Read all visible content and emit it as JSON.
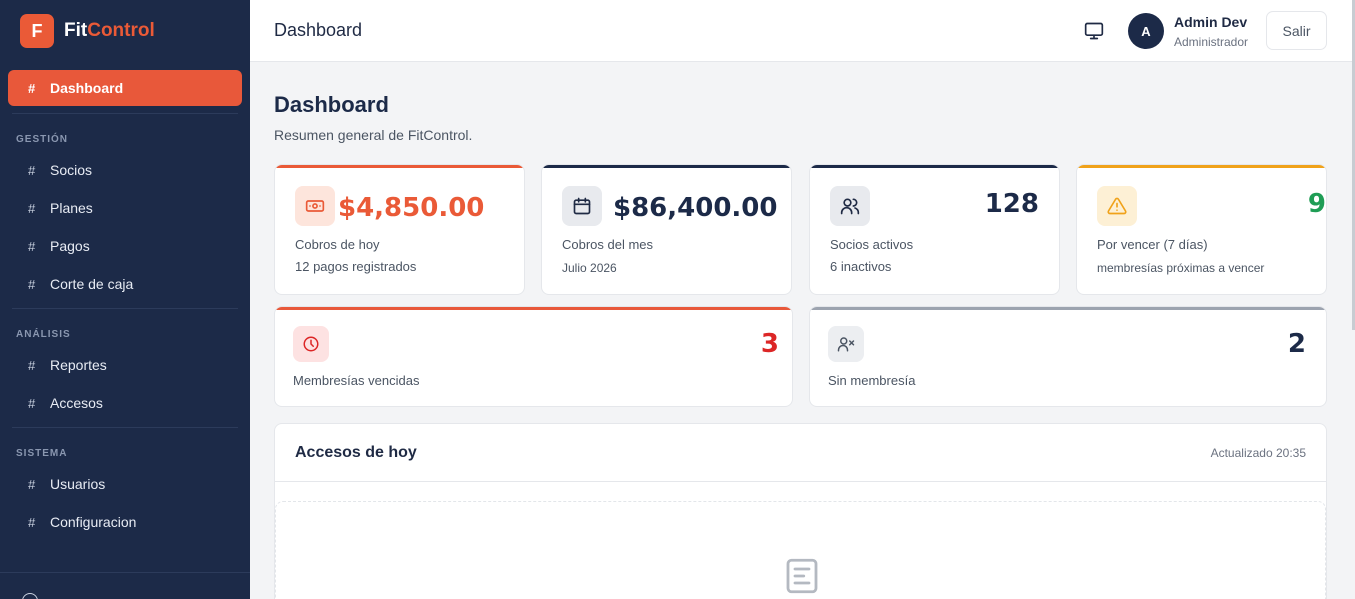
{
  "brand": {
    "logo_letter": "F",
    "name_part1": "Fit",
    "name_part2": "Control"
  },
  "sidebar": {
    "hash": "#",
    "main_item": "Dashboard",
    "sections": [
      {
        "title": "GESTIÓN",
        "items": [
          "Socios",
          "Planes",
          "Pagos",
          "Corte de caja"
        ]
      },
      {
        "title": "ANÁLISIS",
        "items": [
          "Reportes",
          "Accesos"
        ]
      },
      {
        "title": "SISTEMA",
        "items": [
          "Usuarios",
          "Configuracion"
        ]
      }
    ]
  },
  "topbar": {
    "title": "Dashboard",
    "avatar_letter": "A",
    "user_name": "Admin Dev",
    "user_role": "Administrador",
    "logout_label": "Salir"
  },
  "page": {
    "title": "Dashboard",
    "subtitle": "Resumen general de FitControl."
  },
  "stats": {
    "today": {
      "value": "$4,850.00",
      "label": "Cobros de hoy",
      "sub": "12 pagos registrados",
      "icon": "cash-icon"
    },
    "month": {
      "value": "$86,400.00",
      "label": "Cobros del mes",
      "sub": "Julio 2026",
      "icon": "calendar-icon"
    },
    "active": {
      "value": "128",
      "label": "Socios activos",
      "sub": "6 inactivos",
      "icon": "users-icon"
    },
    "expiring": {
      "value": "9",
      "label": "Por vencer (7 días)",
      "sub": "membresías próximas a vencer",
      "icon": "warning-icon"
    },
    "expired": {
      "value": "3",
      "label": "Membresías vencidas",
      "icon": "clock-icon"
    },
    "none": {
      "value": "2",
      "label": "Sin membresía",
      "icon": "user-x-icon"
    }
  },
  "colors": {
    "accent": "#ea5a37",
    "navy": "#1c2a48",
    "amber": "#f0a21a",
    "green": "#1f9d55",
    "red": "#dc2626",
    "gray": "#9ca3af"
  },
  "access": {
    "title": "Accesos de hoy",
    "updated": "Actualizado 20:35"
  }
}
